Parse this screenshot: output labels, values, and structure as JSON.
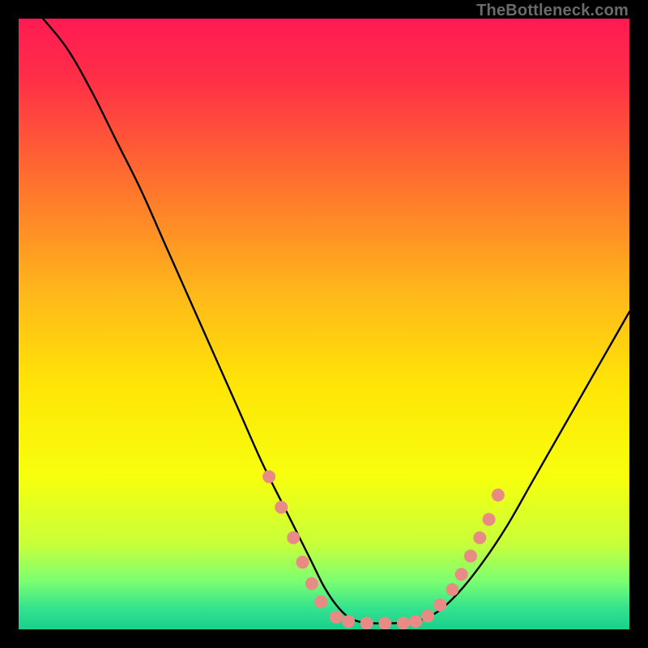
{
  "watermark": "TheBottleneck.com",
  "chart_data": {
    "type": "line",
    "title": "",
    "xlabel": "",
    "ylabel": "",
    "xlim": [
      0,
      100
    ],
    "ylim": [
      0,
      100
    ],
    "grid": false,
    "legend": false,
    "gradient_stops": [
      {
        "offset": 0.0,
        "color": "#ff1a52"
      },
      {
        "offset": 0.1,
        "color": "#ff2f47"
      },
      {
        "offset": 0.25,
        "color": "#ff6a30"
      },
      {
        "offset": 0.45,
        "color": "#ffb81a"
      },
      {
        "offset": 0.6,
        "color": "#ffe507"
      },
      {
        "offset": 0.75,
        "color": "#f7ff0d"
      },
      {
        "offset": 0.86,
        "color": "#c8ff3a"
      },
      {
        "offset": 0.92,
        "color": "#7dff70"
      },
      {
        "offset": 0.965,
        "color": "#34e38e"
      },
      {
        "offset": 1.0,
        "color": "#18cf8c"
      }
    ],
    "series": [
      {
        "name": "bottleneck-curve",
        "color": "#000000",
        "x": [
          4,
          8,
          12,
          16,
          20,
          24,
          28,
          32,
          36,
          40,
          44,
          48,
          50,
          52,
          54,
          56,
          58,
          60,
          64,
          68,
          72,
          76,
          80,
          84,
          88,
          92,
          96,
          100
        ],
        "y": [
          100,
          95,
          88,
          80,
          72,
          63,
          54,
          45,
          36,
          27,
          19,
          11,
          7,
          4,
          2,
          1.2,
          1.0,
          1.0,
          1.2,
          2.5,
          6,
          11,
          17,
          24,
          31,
          38,
          45,
          52
        ]
      }
    ],
    "markers": {
      "name": "highlight-dots",
      "color": "#e98b85",
      "radius": 8,
      "points": [
        {
          "x": 41,
          "y": 25
        },
        {
          "x": 43,
          "y": 20
        },
        {
          "x": 45,
          "y": 15
        },
        {
          "x": 46.5,
          "y": 11
        },
        {
          "x": 48,
          "y": 7.5
        },
        {
          "x": 49.5,
          "y": 4.5
        },
        {
          "x": 52,
          "y": 2.0
        },
        {
          "x": 54,
          "y": 1.3
        },
        {
          "x": 57,
          "y": 1.0
        },
        {
          "x": 60,
          "y": 1.0
        },
        {
          "x": 63,
          "y": 1.0
        },
        {
          "x": 65,
          "y": 1.3
        },
        {
          "x": 67,
          "y": 2.2
        },
        {
          "x": 69,
          "y": 4.0
        },
        {
          "x": 71,
          "y": 6.5
        },
        {
          "x": 72.5,
          "y": 9
        },
        {
          "x": 74,
          "y": 12
        },
        {
          "x": 75.5,
          "y": 15
        },
        {
          "x": 77,
          "y": 18
        },
        {
          "x": 78.5,
          "y": 22
        }
      ]
    }
  }
}
